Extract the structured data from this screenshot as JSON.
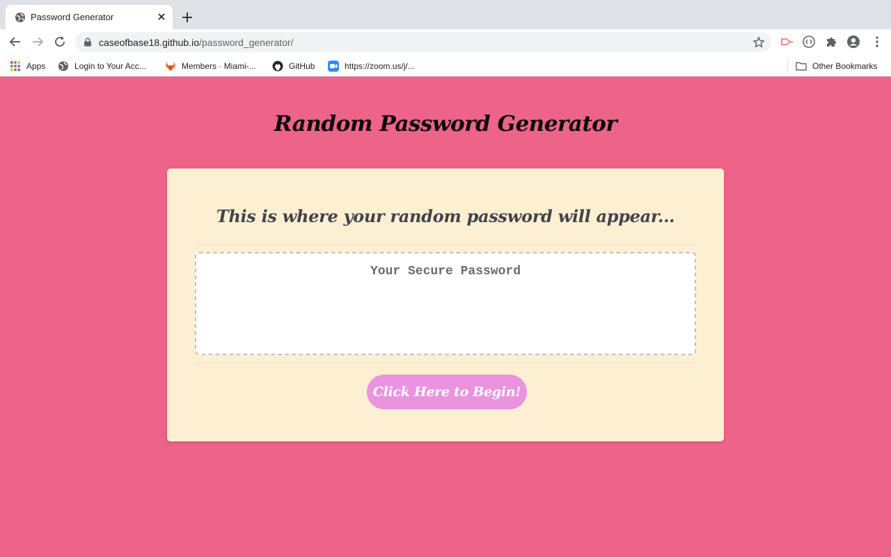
{
  "browser": {
    "tab": {
      "title": "Password Generator"
    },
    "url": {
      "host": "caseofbase18.github.io",
      "path": "/password_generator/"
    },
    "bookmarks": [
      {
        "label": "Apps",
        "icon": "apps-grid-icon"
      },
      {
        "label": "Login to Your Acc...",
        "icon": "globe-icon"
      },
      {
        "label": "Members · Miami-...",
        "icon": "gitlab-icon"
      },
      {
        "label": "GitHub",
        "icon": "github-icon"
      },
      {
        "label": "https://zoom.us/j/...",
        "icon": "zoom-icon"
      }
    ],
    "other_bookmarks": "Other Bookmarks"
  },
  "page": {
    "title": "Random Password Generator",
    "card": {
      "header": "This is where your random password will appear...",
      "password_placeholder": "Your Secure Password",
      "password_value": "",
      "button_label": "Click Here to Begin!"
    }
  },
  "colors": {
    "background": "#ee6389",
    "card": "#fdefd2",
    "button": "#ea94df",
    "title_text": "#0b0b0b"
  }
}
